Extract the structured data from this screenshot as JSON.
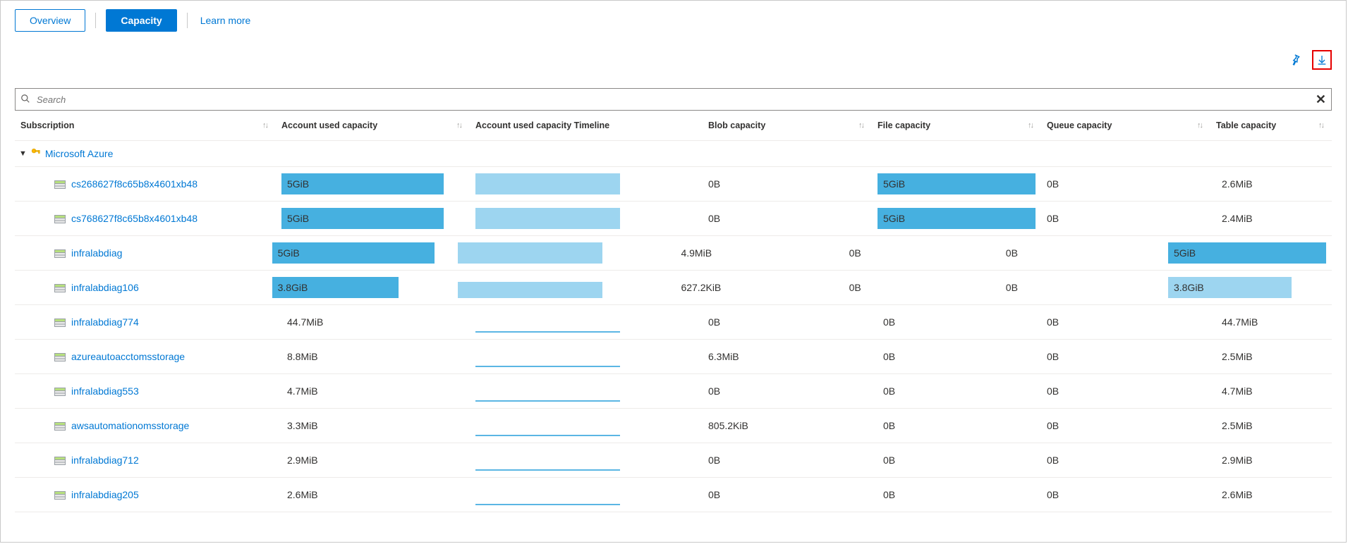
{
  "tabs": {
    "overview": "Overview",
    "capacity": "Capacity",
    "learn_more": "Learn more"
  },
  "search": {
    "placeholder": "Search"
  },
  "columns": {
    "subscription": "Subscription",
    "account_used": "Account used capacity",
    "timeline": "Account used capacity Timeline",
    "blob": "Blob capacity",
    "file": "File capacity",
    "queue": "Queue capacity",
    "table": "Table capacity"
  },
  "group": {
    "name": "Microsoft Azure"
  },
  "colors": {
    "bar_dark": "#46b0e0",
    "bar_light": "#9dd5f0",
    "link": "#0078d4"
  },
  "rows": [
    {
      "name": "cs268627f8c65b8x4601xb48",
      "used": {
        "text": "5GiB",
        "fill_pct": 100,
        "shade": "dark"
      },
      "timeline": {
        "fill_pct": 100,
        "style": "block"
      },
      "blob": "0B",
      "file": {
        "text": "5GiB",
        "fill_pct": 100,
        "shade": "dark"
      },
      "queue": "0B",
      "table": {
        "text": "2.6MiB",
        "fill_pct": 0
      }
    },
    {
      "name": "cs768627f8c65b8x4601xb48",
      "used": {
        "text": "5GiB",
        "fill_pct": 100,
        "shade": "dark"
      },
      "timeline": {
        "fill_pct": 100,
        "style": "block"
      },
      "blob": "0B",
      "file": {
        "text": "5GiB",
        "fill_pct": 100,
        "shade": "dark"
      },
      "queue": "0B",
      "table": {
        "text": "2.4MiB",
        "fill_pct": 0
      }
    },
    {
      "name": "infralabdiag",
      "used": {
        "text": "5GiB",
        "fill_pct": 100,
        "shade": "dark"
      },
      "timeline": {
        "fill_pct": 100,
        "style": "block"
      },
      "blob": "4.9MiB",
      "file": {
        "text": "0B",
        "fill_pct": 0
      },
      "queue": "0B",
      "table": {
        "text": "5GiB",
        "fill_pct": 100,
        "shade": "dark"
      }
    },
    {
      "name": "infralabdiag106",
      "used": {
        "text": "3.8GiB",
        "fill_pct": 78,
        "shade": "dark"
      },
      "timeline": {
        "fill_pct": 78,
        "style": "block"
      },
      "blob": "627.2KiB",
      "file": {
        "text": "0B",
        "fill_pct": 0
      },
      "queue": "0B",
      "table": {
        "text": "3.8GiB",
        "fill_pct": 78,
        "shade": "light"
      }
    },
    {
      "name": "infralabdiag774",
      "used": {
        "text": "44.7MiB",
        "fill_pct": 0
      },
      "timeline": {
        "fill_pct": 2,
        "style": "line"
      },
      "blob": "0B",
      "file": {
        "text": "0B",
        "fill_pct": 0
      },
      "queue": "0B",
      "table": {
        "text": "44.7MiB",
        "fill_pct": 0
      }
    },
    {
      "name": "azureautoacctomsstorage",
      "used": {
        "text": "8.8MiB",
        "fill_pct": 0
      },
      "timeline": {
        "fill_pct": 2,
        "style": "line"
      },
      "blob": "6.3MiB",
      "file": {
        "text": "0B",
        "fill_pct": 0
      },
      "queue": "0B",
      "table": {
        "text": "2.5MiB",
        "fill_pct": 0
      }
    },
    {
      "name": "infralabdiag553",
      "used": {
        "text": "4.7MiB",
        "fill_pct": 0
      },
      "timeline": {
        "fill_pct": 2,
        "style": "line"
      },
      "blob": "0B",
      "file": {
        "text": "0B",
        "fill_pct": 0
      },
      "queue": "0B",
      "table": {
        "text": "4.7MiB",
        "fill_pct": 0
      }
    },
    {
      "name": "awsautomationomsstorage",
      "used": {
        "text": "3.3MiB",
        "fill_pct": 0
      },
      "timeline": {
        "fill_pct": 2,
        "style": "line"
      },
      "blob": "805.2KiB",
      "file": {
        "text": "0B",
        "fill_pct": 0
      },
      "queue": "0B",
      "table": {
        "text": "2.5MiB",
        "fill_pct": 0
      }
    },
    {
      "name": "infralabdiag712",
      "used": {
        "text": "2.9MiB",
        "fill_pct": 0
      },
      "timeline": {
        "fill_pct": 2,
        "style": "line"
      },
      "blob": "0B",
      "file": {
        "text": "0B",
        "fill_pct": 0
      },
      "queue": "0B",
      "table": {
        "text": "2.9MiB",
        "fill_pct": 0
      }
    },
    {
      "name": "infralabdiag205",
      "used": {
        "text": "2.6MiB",
        "fill_pct": 0
      },
      "timeline": {
        "fill_pct": 2,
        "style": "line"
      },
      "blob": "0B",
      "file": {
        "text": "0B",
        "fill_pct": 0
      },
      "queue": "0B",
      "table": {
        "text": "2.6MiB",
        "fill_pct": 0
      }
    }
  ]
}
